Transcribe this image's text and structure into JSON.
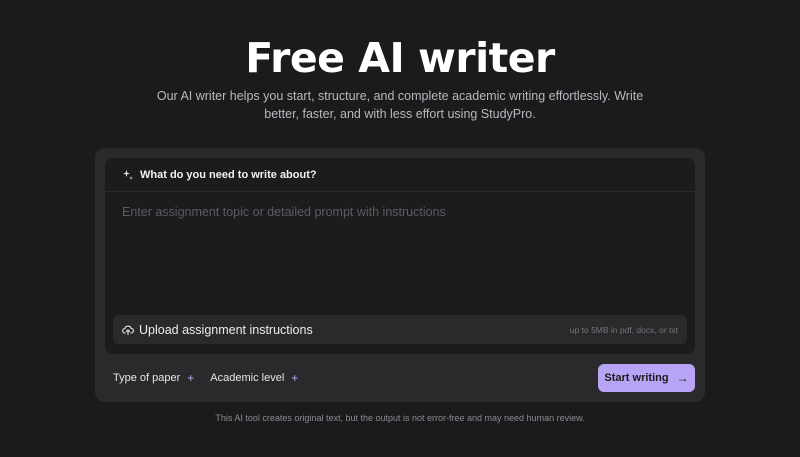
{
  "hero": {
    "title": "Free AI writer",
    "subtitle": "Our AI writer helps you start, structure, and complete academic writing effortlessly. Write better, faster, and with less effort using StudyPro."
  },
  "form": {
    "prompt_label": "What do you need to write about?",
    "prompt_placeholder": "Enter assignment topic or detailed prompt with instructions",
    "prompt_value": "",
    "upload_label": "Upload assignment instructions",
    "upload_hint": "up to 5MB in pdf, docx, or txt",
    "type_of_paper_label": "Type of paper",
    "academic_level_label": "Academic level",
    "plus_glyph": "+",
    "start_button_label": "Start writing",
    "start_button_arrow": "→"
  },
  "footer": {
    "disclaimer": "This AI tool creates original text, but the output is not error-free and may need human review."
  },
  "colors": {
    "background": "#1b1b1d",
    "card": "#2a2a2c",
    "accent": "#b8a4f4"
  },
  "icons": {
    "sparkle": "sparkle-icon",
    "upload": "cloud-upload-icon",
    "plus": "plus-icon",
    "arrow": "arrow-right-icon"
  }
}
